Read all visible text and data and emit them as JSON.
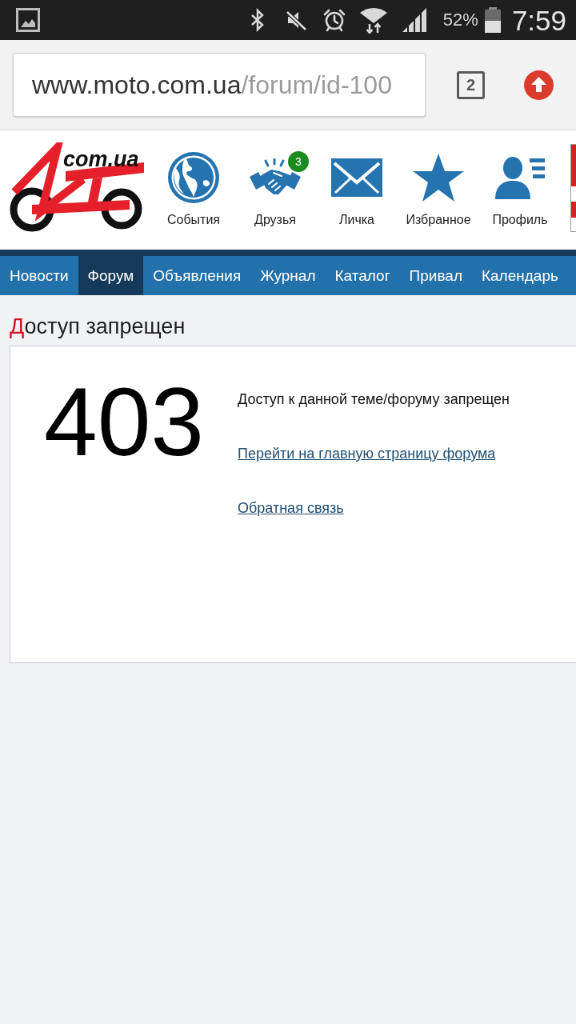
{
  "status_bar": {
    "battery_percent": "52%",
    "time": "7:59"
  },
  "browser_toolbar": {
    "url": {
      "host": "www.moto.com.ua",
      "path": "/forum/id-100"
    },
    "tab_count": "2"
  },
  "site_header": {
    "logo_text": "com.ua",
    "shortcuts": [
      {
        "kind": "globe",
        "label": "События"
      },
      {
        "kind": "handshake",
        "label": "Друзья",
        "badge": "3"
      },
      {
        "kind": "envelope",
        "label": "Личка"
      },
      {
        "kind": "star",
        "label": "Избранное"
      },
      {
        "kind": "profile",
        "label": "Профиль"
      }
    ]
  },
  "nav": {
    "items": [
      {
        "label": "Новости",
        "selected": false
      },
      {
        "label": "Форум",
        "selected": true
      },
      {
        "label": "Объявления",
        "selected": false
      },
      {
        "label": "Журнал",
        "selected": false
      },
      {
        "label": "Каталог",
        "selected": false
      },
      {
        "label": "Привал",
        "selected": false
      },
      {
        "label": "Календарь",
        "selected": false
      }
    ]
  },
  "page": {
    "title": "Доступ запрещен",
    "error": {
      "code": "403",
      "message": "Доступ к данной теме/форуму запрещен",
      "links": [
        "Перейти на главную страницу форума",
        "Обратная связь"
      ]
    }
  }
}
